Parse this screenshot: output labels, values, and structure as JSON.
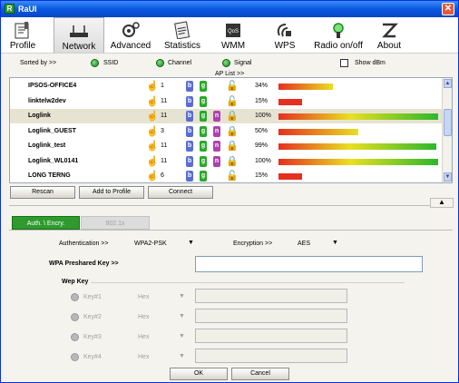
{
  "window": {
    "app_icon": "R",
    "title": "RaUI",
    "close_label": "✕"
  },
  "toolbar": [
    {
      "label": "Profile",
      "icon": "profile-icon"
    },
    {
      "label": "Network",
      "icon": "network-icon"
    },
    {
      "label": "Advanced",
      "icon": "advanced-icon"
    },
    {
      "label": "Statistics",
      "icon": "statistics-icon"
    },
    {
      "label": "WMM",
      "icon": "wmm-icon"
    },
    {
      "label": "WPS",
      "icon": "wps-icon"
    },
    {
      "label": "Radio on/off",
      "icon": "radio-icon"
    },
    {
      "label": "About",
      "icon": "about-icon"
    }
  ],
  "sortbar": {
    "sorted_by": "Sorted by >>",
    "ssid": "SSID",
    "channel": "Channel",
    "signal": "Signal",
    "show_dbm": "Show dBm"
  },
  "ap_list_label": "AP List >>",
  "ap_list": [
    {
      "ssid": "IPSOS-OFFICE4",
      "channel": "1",
      "pct": "34%",
      "signal": 34
    },
    {
      "ssid": "linktelw2dev",
      "channel": "11",
      "pct": "15%",
      "signal": 15
    },
    {
      "ssid": "Loglink",
      "channel": "11",
      "pct": "100%",
      "signal": 100
    },
    {
      "ssid": "Loglink_GUEST",
      "channel": "3",
      "pct": "50%",
      "signal": 50
    },
    {
      "ssid": "Loglink_test",
      "channel": "11",
      "pct": "99%",
      "signal": 99
    },
    {
      "ssid": "Loglink_WL0141",
      "channel": "11",
      "pct": "100%",
      "signal": 100
    },
    {
      "ssid": "LONG TERNG",
      "channel": "6",
      "pct": "15%",
      "signal": 15
    }
  ],
  "buttons": {
    "rescan": "Rescan",
    "add_to_profile": "Add to Profile",
    "connect": "Connect",
    "ok": "OK",
    "cancel": "Cancel"
  },
  "tabs": {
    "auth": "Auth. \\ Encry.",
    "8021x": "802.1x"
  },
  "auth": {
    "authentication_label": "Authentication >>",
    "authentication_value": "WPA2-PSK",
    "encryption_label": "Encryption >>",
    "encryption_value": "AES",
    "wpa_key_label": "WPA Preshared Key >>",
    "wpa_key_value": "",
    "wep_key_label": "Wep Key",
    "keys": [
      {
        "label": "Key#1",
        "type": "Hex"
      },
      {
        "label": "Key#2",
        "type": "Hex"
      },
      {
        "label": "Key#3",
        "type": "Hex"
      },
      {
        "label": "Key#4",
        "type": "Hex"
      }
    ]
  },
  "colors": {
    "title_blue": "#0a58e0",
    "accent_green": "#2f9b2f",
    "bar_red": "#e53020",
    "bar_yellow": "#e8e020",
    "bar_green": "#2bb82b"
  }
}
